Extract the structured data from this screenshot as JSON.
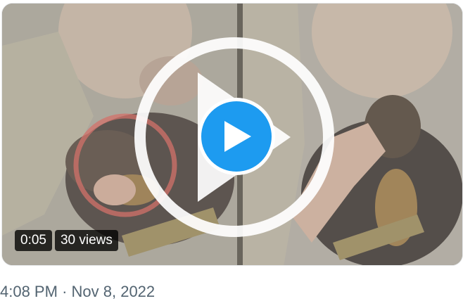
{
  "video": {
    "duration": "0:05",
    "views": "30 views",
    "play_label": "Play video"
  },
  "tweet": {
    "time": "4:08 PM",
    "separator": "·",
    "date": "Nov 8, 2022"
  },
  "colors": {
    "play_button": "#1d9bf0",
    "badge_bg": "#000000",
    "timestamp": "#536471"
  },
  "icons": {
    "play": "play-icon",
    "overlay": "play-logo-watermark"
  }
}
